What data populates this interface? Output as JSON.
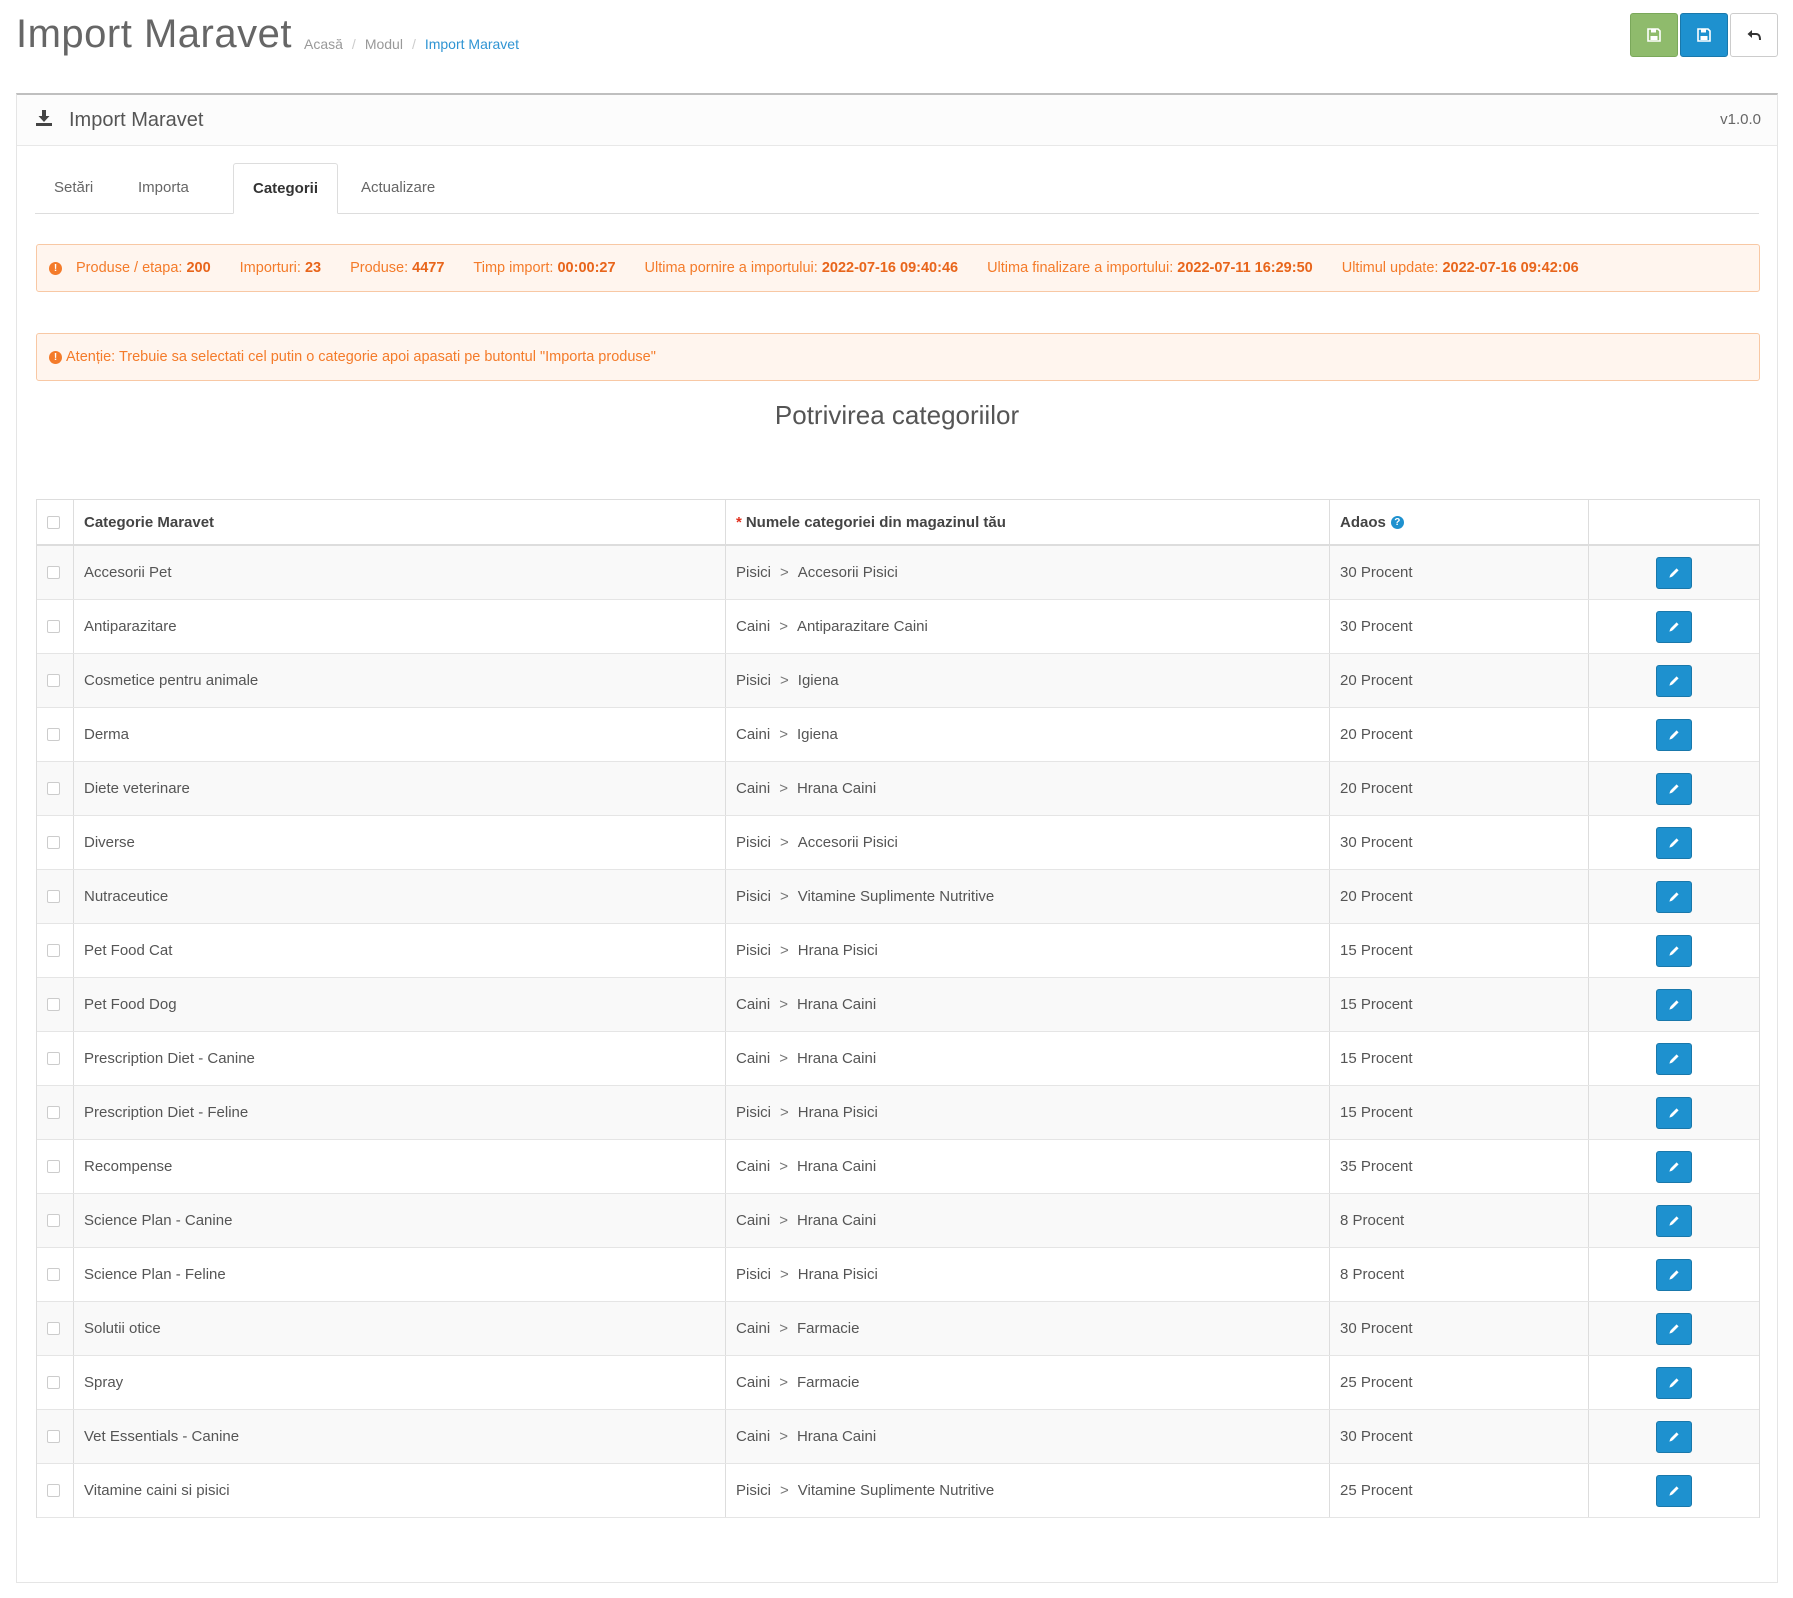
{
  "header": {
    "title": "Import Maravet",
    "breadcrumb": [
      "Acasă",
      "Modul",
      "Import Maravet"
    ]
  },
  "panel": {
    "title": "Import Maravet",
    "version": "v1.0.0"
  },
  "tabs": [
    {
      "label": "Setări",
      "active": false
    },
    {
      "label": "Importa",
      "active": false
    },
    {
      "label": "Categorii",
      "active": true
    },
    {
      "label": "Actualizare",
      "active": false
    }
  ],
  "stats": [
    {
      "label": "Produse / etapa:",
      "value": "200"
    },
    {
      "label": "Importuri:",
      "value": "23"
    },
    {
      "label": "Produse:",
      "value": "4477"
    },
    {
      "label": "Timp import:",
      "value": "00:00:27"
    },
    {
      "label": "Ultima pornire a importului:",
      "value": "2022-07-16 09:40:46"
    },
    {
      "label": "Ultima finalizare a importului:",
      "value": "2022-07-11 16:29:50"
    },
    {
      "label": "Ultimul update:",
      "value": "2022-07-16 09:42:06"
    }
  ],
  "notice": "Atenție: Trebuie sa selectati cel putin o categorie apoi apasati pe butontul \"Importa produse\"",
  "section_title": "Potrivirea categoriilor",
  "table": {
    "headers": {
      "category": "Categorie Maravet",
      "required_mark": "*",
      "shop_category": "Numele categoriei din magazinul tău",
      "markup": "Adaos"
    },
    "path_separator": ">",
    "rows": [
      {
        "category": "Accesorii Pet",
        "parent": "Pisici",
        "child": "Accesorii Pisici",
        "markup": "30 Procent"
      },
      {
        "category": "Antiparazitare",
        "parent": "Caini",
        "child": "Antiparazitare Caini",
        "markup": "30 Procent"
      },
      {
        "category": "Cosmetice pentru animale",
        "parent": "Pisici",
        "child": "Igiena",
        "markup": "20 Procent"
      },
      {
        "category": "Derma",
        "parent": "Caini",
        "child": "Igiena",
        "markup": "20 Procent"
      },
      {
        "category": "Diete veterinare",
        "parent": "Caini",
        "child": "Hrana Caini",
        "markup": "20 Procent"
      },
      {
        "category": "Diverse",
        "parent": "Pisici",
        "child": "Accesorii Pisici",
        "markup": "30 Procent"
      },
      {
        "category": "Nutraceutice",
        "parent": "Pisici",
        "child": "Vitamine Suplimente Nutritive",
        "markup": "20 Procent"
      },
      {
        "category": "Pet Food Cat",
        "parent": "Pisici",
        "child": "Hrana Pisici",
        "markup": "15 Procent"
      },
      {
        "category": "Pet Food Dog",
        "parent": "Caini",
        "child": "Hrana Caini",
        "markup": "15 Procent"
      },
      {
        "category": "Prescription Diet - Canine",
        "parent": "Caini",
        "child": "Hrana Caini",
        "markup": "15 Procent"
      },
      {
        "category": "Prescription Diet - Feline",
        "parent": "Pisici",
        "child": "Hrana Pisici",
        "markup": "15 Procent"
      },
      {
        "category": "Recompense",
        "parent": "Caini",
        "child": "Hrana Caini",
        "markup": "35 Procent"
      },
      {
        "category": "Science Plan - Canine",
        "parent": "Caini",
        "child": "Hrana Caini",
        "markup": "8 Procent"
      },
      {
        "category": "Science Plan - Feline",
        "parent": "Pisici",
        "child": "Hrana Pisici",
        "markup": "8 Procent"
      },
      {
        "category": "Solutii otice",
        "parent": "Caini",
        "child": "Farmacie",
        "markup": "30 Procent"
      },
      {
        "category": "Spray",
        "parent": "Caini",
        "child": "Farmacie",
        "markup": "25 Procent"
      },
      {
        "category": "Vet Essentials - Canine",
        "parent": "Caini",
        "child": "Hrana Caini",
        "markup": "30 Procent"
      },
      {
        "category": "Vitamine caini si pisici",
        "parent": "Pisici",
        "child": "Vitamine Suplimente Nutritive",
        "markup": "25 Procent"
      }
    ]
  },
  "colors": {
    "primary": "#1e91cf",
    "success": "#8fbb6c",
    "warning": "#f47b2a"
  }
}
